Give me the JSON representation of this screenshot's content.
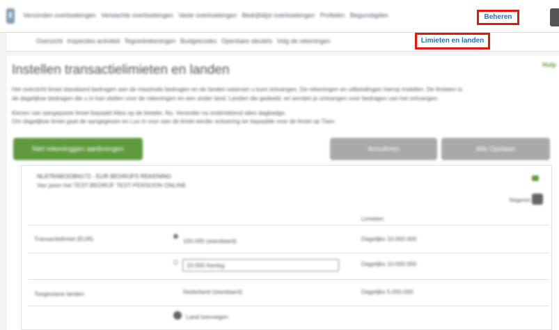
{
  "top_nav": {
    "tabs": [
      "Verzonden overboekingen",
      "Verwachte overboekingen",
      "Vaste overboekingen",
      "Bedrijfslijst overboekingen",
      "Profielen",
      "Begunstigden"
    ],
    "active": "Beheren"
  },
  "sub_nav": {
    "tabs": [
      "Overzicht",
      "Inspecties activiteit",
      "Tegoedrekeningen",
      "Budgetcodes",
      "Openbare sleutels",
      "Volg de rekeningen"
    ],
    "active": "Limieten en landen"
  },
  "page": {
    "title": "Instellen transactielimieten en landen",
    "help": "Hulp",
    "description_1": "Het overzicht limiet standaard bedragen aan de maximale bedragen en de landen waarvan u kunt ontvangen. De rekeningen en uitbetalingen hierop instellen. De limieten is",
    "description_2": "de dagelijkse bedragen die u in kan stellen voor de rekeningen en een ander land. Landen die gedeeld, en worden je ontvangen voor bedragen van het ontvangen.",
    "description_3": "Kiezen van aangepaste limiet bepaald Alles op de betaler, Nu. Verander na ondertekend alles dagbadge.",
    "description_4": "Om dagelijkse limiet gaat de aangegeven en Lux in voor aan de limiet eerder activering ter bepaalde voor de limiet op Tiam."
  },
  "buttons": {
    "new_limit": "Niet rekeninggen aanbrengen",
    "cancel": "Annuleren",
    "save": "Alle Opslaan"
  },
  "card": {
    "title": "NL87RABO0384172 - EUR BEDRIJFS REKENING",
    "subtitle": "Van jaren het TEST-BEDRIJF TEST-PERSOON ONLINE",
    "toggle_label": "Negeren"
  },
  "table": {
    "header_right": "Limieten",
    "row1_label": "Transactielimiet (EUR)",
    "row1_value": "100.000 (standaard)",
    "row1_right": "Dagelijks 10.000.000",
    "row2_input": "10.000 Aanleg",
    "row2_right": "Dagelijks 10.000.000",
    "row3_label": "Toegestane landen",
    "row3_middle": "Nederland (standaard)",
    "row3_right": "Dagelijks 5.000.000",
    "add_label": "Land toevoegen"
  }
}
